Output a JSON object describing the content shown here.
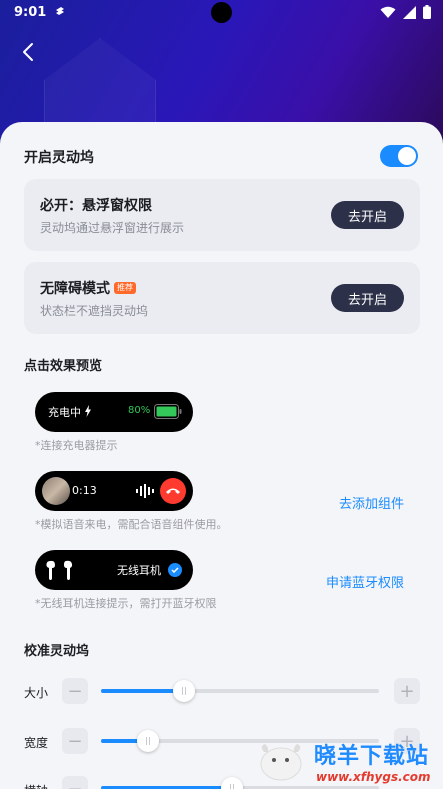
{
  "status_bar": {
    "time": "9:01"
  },
  "main_switch": {
    "label": "开启灵动坞",
    "enabled": true
  },
  "cards": [
    {
      "title": "必开：悬浮窗权限",
      "subtitle": "灵动坞通过悬浮窗进行展示",
      "button": "去开启",
      "badge": ""
    },
    {
      "title": "无障碍模式",
      "subtitle": "状态栏不遮挡灵动坞",
      "button": "去开启",
      "badge": "推荐"
    }
  ],
  "preview": {
    "title": "点击效果预览",
    "charging": {
      "label": "充电中",
      "percent": "80%",
      "caption": "*连接充电器提示"
    },
    "call": {
      "timer": "0:13",
      "caption": "*模拟语音来电，需配合语音组件使用。",
      "link": "去添加组件"
    },
    "earbuds": {
      "label": "无线耳机",
      "caption": "*无线耳机连接提示，需打开蓝牙权限",
      "link": "申请蓝牙权限"
    }
  },
  "calibrate": {
    "title": "校准灵动坞",
    "sliders": [
      {
        "label": "大小",
        "value": 0.3
      },
      {
        "label": "宽度",
        "value": 0.17
      },
      {
        "label": "横轴",
        "value": 0.47
      }
    ]
  },
  "watermark": {
    "title": "晓羊下载站",
    "url": "www.xfhygs.com"
  },
  "colors": {
    "accent": "#1a8cff",
    "button_dark": "#2c3048",
    "badge": "#ff6a2b",
    "battery": "#34c759",
    "hangup": "#ff3b30"
  }
}
